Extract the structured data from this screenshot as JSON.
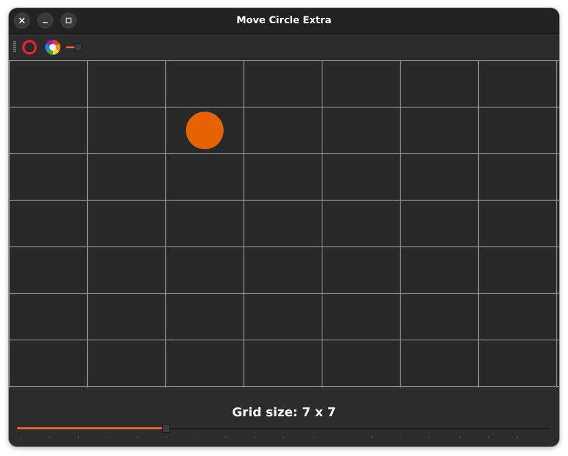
{
  "window": {
    "title": "Move Circle Extra",
    "controls": [
      "close-icon",
      "minimize-icon",
      "maximize-icon"
    ]
  },
  "toolbar": {
    "tools": [
      {
        "name": "circle-tool",
        "icon": "circle-ring-icon",
        "color": "#e0283a"
      },
      {
        "name": "color-tool",
        "icon": "color-wheel-icon"
      },
      {
        "name": "slider-tool",
        "icon": "slider-icon"
      }
    ]
  },
  "board": {
    "rows": 7,
    "columns": 7,
    "background": "#282828",
    "line_color": "#8f8f8f",
    "circle": {
      "row": 1,
      "column": 2,
      "color": "#e66100"
    }
  },
  "footer": {
    "grid_size_label": "Grid size: 7 x 7",
    "slider": {
      "value_fraction": 0.28,
      "fill_color": "#e95f3b",
      "tick_count": 19
    }
  }
}
